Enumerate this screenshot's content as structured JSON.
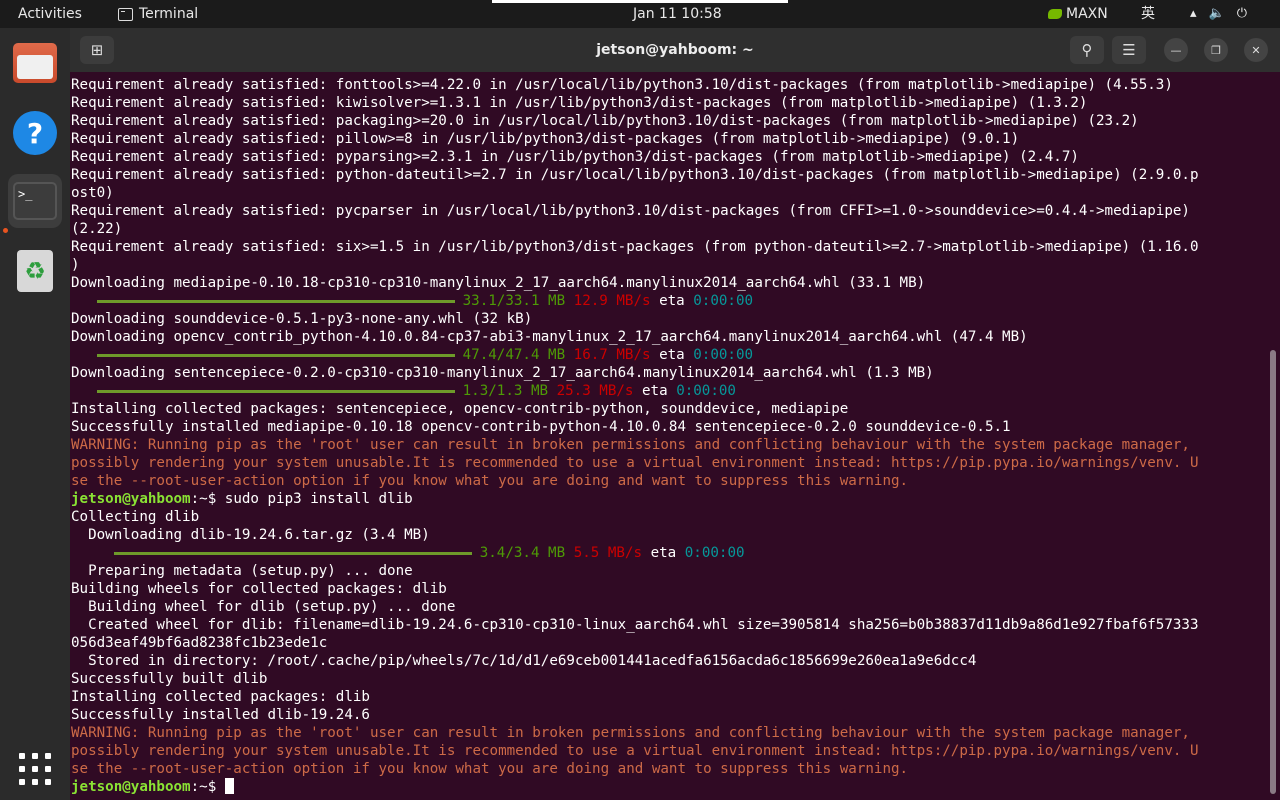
{
  "topbar": {
    "activities": "Activities",
    "app_name": "Terminal",
    "clock": "Jan 11  10:58",
    "power_mode": "MAXN",
    "input_method": "英",
    "status_icons": [
      "network-icon",
      "volume-icon",
      "power-icon"
    ]
  },
  "dock": {
    "items": [
      "files-app",
      "help-app",
      "terminal-app",
      "trash",
      "show-apps"
    ]
  },
  "window": {
    "title": "jetson@yahboom: ~"
  },
  "colors": {
    "terminal_bg": "#300a24",
    "prompt_green": "#8ae234",
    "warning_orange": "#cd6a47",
    "progress_green": "#4e9a06",
    "rate_red": "#cc0000",
    "eta_cyan": "#06989a"
  },
  "terminal": {
    "lines": [
      {
        "type": "text",
        "text": "Requirement already satisfied: fonttools>=4.22.0 in /usr/local/lib/python3.10/dist-packages (from matplotlib->mediapipe) (4.55.3)"
      },
      {
        "type": "text",
        "text": "Requirement already satisfied: kiwisolver>=1.3.1 in /usr/lib/python3/dist-packages (from matplotlib->mediapipe) (1.3.2)"
      },
      {
        "type": "text",
        "text": "Requirement already satisfied: packaging>=20.0 in /usr/local/lib/python3.10/dist-packages (from matplotlib->mediapipe) (23.2)"
      },
      {
        "type": "text",
        "text": "Requirement already satisfied: pillow>=8 in /usr/lib/python3/dist-packages (from matplotlib->mediapipe) (9.0.1)"
      },
      {
        "type": "text",
        "text": "Requirement already satisfied: pyparsing>=2.3.1 in /usr/lib/python3/dist-packages (from matplotlib->mediapipe) (2.4.7)"
      },
      {
        "type": "text",
        "text": "Requirement already satisfied: python-dateutil>=2.7 in /usr/local/lib/python3.10/dist-packages (from matplotlib->mediapipe) (2.9.0.p"
      },
      {
        "type": "text",
        "text": "ost0)"
      },
      {
        "type": "text",
        "text": "Requirement already satisfied: pycparser in /usr/local/lib/python3.10/dist-packages (from CFFI>=1.0->sounddevice>=0.4.4->mediapipe)"
      },
      {
        "type": "text",
        "text": "(2.22)"
      },
      {
        "type": "text",
        "text": "Requirement already satisfied: six>=1.5 in /usr/lib/python3/dist-packages (from python-dateutil>=2.7->matplotlib->mediapipe) (1.16.0"
      },
      {
        "type": "text",
        "text": ")"
      },
      {
        "type": "text",
        "text": "Downloading mediapipe-0.10.18-cp310-cp310-manylinux_2_17_aarch64.manylinux2014_aarch64.whl (33.1 MB)"
      },
      {
        "type": "progress",
        "indent": "   ",
        "bar_chars": 40,
        "done": "33.1/33.1 MB",
        "rate": "12.9 MB/s",
        "eta_label": "eta",
        "eta": "0:00:00"
      },
      {
        "type": "text",
        "text": "Downloading sounddevice-0.5.1-py3-none-any.whl (32 kB)"
      },
      {
        "type": "text",
        "text": "Downloading opencv_contrib_python-4.10.0.84-cp37-abi3-manylinux_2_17_aarch64.manylinux2014_aarch64.whl (47.4 MB)"
      },
      {
        "type": "progress",
        "indent": "   ",
        "bar_chars": 40,
        "done": "47.4/47.4 MB",
        "rate": "16.7 MB/s",
        "eta_label": "eta",
        "eta": "0:00:00"
      },
      {
        "type": "text",
        "text": "Downloading sentencepiece-0.2.0-cp310-cp310-manylinux_2_17_aarch64.manylinux2014_aarch64.whl (1.3 MB)"
      },
      {
        "type": "progress",
        "indent": "   ",
        "bar_chars": 40,
        "done": "1.3/1.3 MB",
        "rate": "25.3 MB/s",
        "eta_label": "eta",
        "eta": "0:00:00"
      },
      {
        "type": "text",
        "text": "Installing collected packages: sentencepiece, opencv-contrib-python, sounddevice, mediapipe"
      },
      {
        "type": "text",
        "text": "Successfully installed mediapipe-0.10.18 opencv-contrib-python-4.10.0.84 sentencepiece-0.2.0 sounddevice-0.5.1"
      },
      {
        "type": "warn",
        "text": "WARNING: Running pip as the 'root' user can result in broken permissions and conflicting behaviour with the system package manager,"
      },
      {
        "type": "warn",
        "text": "possibly rendering your system unusable.It is recommended to use a virtual environment instead: https://pip.pypa.io/warnings/venv. U"
      },
      {
        "type": "warn",
        "text": "se the --root-user-action option if you know what you are doing and want to suppress this warning."
      },
      {
        "type": "prompt",
        "user": "jetson@yahboom",
        "path": ":~",
        "symbol": "$ ",
        "cmd": "sudo pip3 install dlib"
      },
      {
        "type": "text",
        "text": "Collecting dlib"
      },
      {
        "type": "text",
        "text": "  Downloading dlib-19.24.6.tar.gz (3.4 MB)"
      },
      {
        "type": "progress",
        "indent": "     ",
        "bar_chars": 40,
        "done": "3.4/3.4 MB",
        "rate": "5.5 MB/s",
        "eta_label": "eta",
        "eta": "0:00:00"
      },
      {
        "type": "text",
        "text": "  Preparing metadata (setup.py) ... done"
      },
      {
        "type": "text",
        "text": "Building wheels for collected packages: dlib"
      },
      {
        "type": "text",
        "text": "  Building wheel for dlib (setup.py) ... done"
      },
      {
        "type": "text",
        "text": "  Created wheel for dlib: filename=dlib-19.24.6-cp310-cp310-linux_aarch64.whl size=3905814 sha256=b0b38837d11db9a86d1e927fbaf6f57333"
      },
      {
        "type": "text",
        "text": "056d3eaf49bf6ad8238fc1b23ede1c"
      },
      {
        "type": "text",
        "text": "  Stored in directory: /root/.cache/pip/wheels/7c/1d/d1/e69ceb001441acedfa6156acda6c1856699e260ea1a9e6dcc4"
      },
      {
        "type": "text",
        "text": "Successfully built dlib"
      },
      {
        "type": "text",
        "text": "Installing collected packages: dlib"
      },
      {
        "type": "text",
        "text": "Successfully installed dlib-19.24.6"
      },
      {
        "type": "warn",
        "text": "WARNING: Running pip as the 'root' user can result in broken permissions and conflicting behaviour with the system package manager,"
      },
      {
        "type": "warn",
        "text": "possibly rendering your system unusable.It is recommended to use a virtual environment instead: https://pip.pypa.io/warnings/venv. U"
      },
      {
        "type": "warn",
        "text": "se the --root-user-action option if you know what you are doing and want to suppress this warning."
      },
      {
        "type": "prompt",
        "user": "jetson@yahboom",
        "path": ":~",
        "symbol": "$ ",
        "cmd": "",
        "cursor": true
      }
    ]
  }
}
